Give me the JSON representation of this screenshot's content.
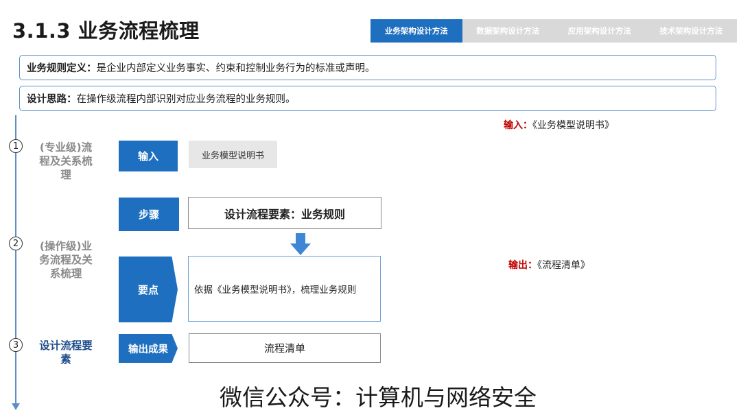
{
  "header": {
    "title": "3.1.3 业务流程梳理",
    "tabs": [
      {
        "label": "业务架构设计方法",
        "active": true
      },
      {
        "label": "数据架构设计方法",
        "active": false
      },
      {
        "label": "应用架构设计方法",
        "active": false
      },
      {
        "label": "技术架构设计方法",
        "active": false
      }
    ]
  },
  "definitions": {
    "rule_label": "业务规则定义：",
    "rule_text": "是企业内部定义业务事实、约束和控制业务行为的标准或声明。",
    "idea_label": "设计思路：",
    "idea_text": "在操作级流程内部识别对应业务流程的业务规则。"
  },
  "stages": [
    {
      "num": "1",
      "line1": "(专业级)流",
      "line2": "程及关系梳",
      "line3": "理"
    },
    {
      "num": "2",
      "line1": "(操作级)业",
      "line2": "务流程及关",
      "line3": "系梳理"
    },
    {
      "num": "3",
      "line1": "设计流程要",
      "line2": "素",
      "line3": ""
    }
  ],
  "steps": {
    "input_label": "输入",
    "input_value": "业务模型说明书",
    "step_label": "步骤",
    "step_value": "设计流程要素：业务规则",
    "key_label": "要点",
    "key_value": "依据《业务模型说明书》，梳理业务规则",
    "output_label": "输出成果",
    "output_value": "流程清单"
  },
  "notes": {
    "input_label": "输入：",
    "input_value": "《业务模型说明书》",
    "output_label": "输出：",
    "output_value": "《流程清单》"
  },
  "watermark": "微信公众号：计算机与网络安全",
  "colors": {
    "primary": "#1f6fc0",
    "highlight_red": "#c00000",
    "timeline": "#5e8fc4"
  }
}
